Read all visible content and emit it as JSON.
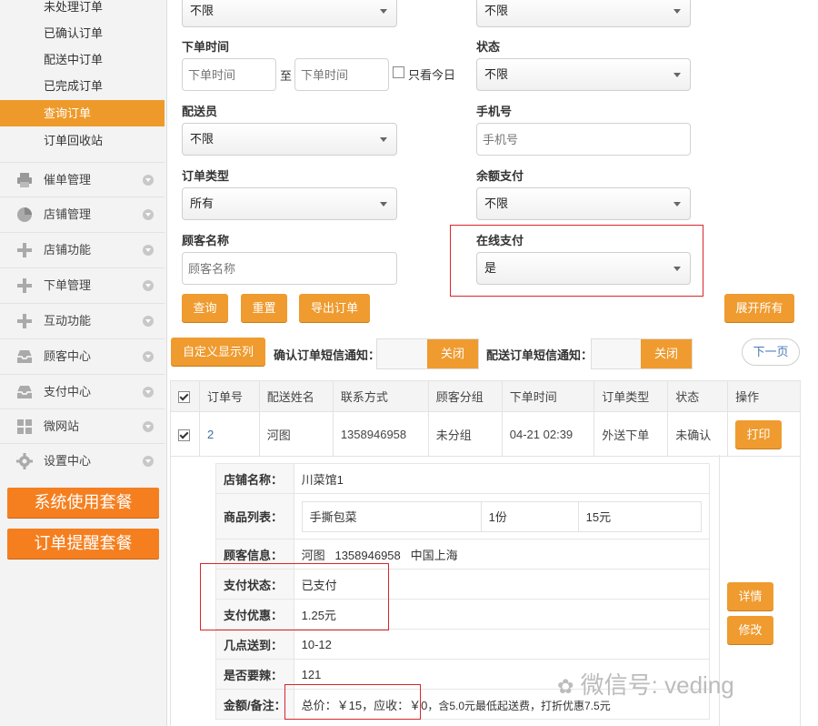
{
  "sidebar": {
    "sub_items": [
      {
        "label": "未处理订单",
        "active": false
      },
      {
        "label": "已确认订单",
        "active": false
      },
      {
        "label": "配送中订单",
        "active": false
      },
      {
        "label": "已完成订单",
        "active": false
      },
      {
        "label": "查询订单",
        "active": true
      },
      {
        "label": "订单回收站",
        "active": false
      }
    ],
    "sections": [
      {
        "label": "催单管理",
        "icon": "printer-icon"
      },
      {
        "label": "店铺管理",
        "icon": "pie-chart-icon"
      },
      {
        "label": "店铺功能",
        "icon": "plus-icon"
      },
      {
        "label": "下单管理",
        "icon": "plus-icon"
      },
      {
        "label": "互动功能",
        "icon": "plus-icon"
      },
      {
        "label": "顾客中心",
        "icon": "inbox-icon"
      },
      {
        "label": "支付中心",
        "icon": "inbox-icon"
      },
      {
        "label": "微网站",
        "icon": "grid-icon"
      },
      {
        "label": "设置中心",
        "icon": "gear-icon"
      }
    ],
    "big_buttons": [
      "系统使用套餐",
      "订单提醒套餐"
    ]
  },
  "filters": {
    "top_left_value": "不限",
    "top_right_value": "不限",
    "order_time_label": "下单时间",
    "order_time_from_placeholder": "下单时间",
    "order_time_sep": "至",
    "order_time_to_placeholder": "下单时间",
    "today_only_label": "只看今日",
    "status_label": "状态",
    "status_value": "不限",
    "courier_label": "配送员",
    "courier_value": "不限",
    "phone_label": "手机号",
    "phone_placeholder": "手机号",
    "order_type_label": "订单类型",
    "order_type_value": "所有",
    "balance_pay_label": "余额支付",
    "balance_pay_value": "不限",
    "customer_name_label": "顾客名称",
    "customer_name_placeholder": "顾客名称",
    "online_pay_label": "在线支付",
    "online_pay_value": "是"
  },
  "actions": {
    "query": "查询",
    "reset": "重置",
    "export": "导出订单",
    "expand_all": "展开所有",
    "custom_columns": "自定义显示列",
    "confirm_sms_label": "确认订单短信通知：",
    "confirm_sms_toggle": "关闭",
    "delivery_sms_label": "配送订单短信通知：",
    "delivery_sms_toggle": "关闭",
    "next_page": "下一页"
  },
  "table": {
    "headers": [
      "订单号",
      "配送姓名",
      "联系方式",
      "顾客分组",
      "下单时间",
      "订单类型",
      "状态",
      "操作"
    ],
    "row": {
      "order_no": "2",
      "name": "河图",
      "phone": "1358946958",
      "group": "未分组",
      "time": "04-21 02:39",
      "type": "外送下单",
      "status": "未确认",
      "print_button": "打印"
    }
  },
  "detail": {
    "shop_label": "店铺名称：",
    "shop_value": "川菜馆1",
    "goods_label": "商品列表：",
    "goods": {
      "name": "手撕包菜",
      "qty": "1份",
      "price": "15元"
    },
    "customer_label": "顾客信息：",
    "customer_value": "河图   1358946958   中国上海",
    "pay_status_label": "支付状态：",
    "pay_status_value": "已支付",
    "pay_discount_label": "支付优惠：",
    "pay_discount_value": "1.25元",
    "delivery_time_label": "几点送到：",
    "delivery_time_value": "10-12",
    "spicy_label": "是否要辣：",
    "spicy_value": "121",
    "amount_label": "金额/备注：",
    "amount_total": "总价：￥15，应收：￥0",
    "amount_note": "，含5.0元最低起送费，打折优惠7.5元",
    "details_button": "详情",
    "modify_button": "修改"
  },
  "watermark": "微信号: veding",
  "colors": {
    "accent": "#ef9b2f",
    "sidebar_active": "#ee9a2a",
    "big_button": "#f57f1f",
    "highlight_box": "#d9252a"
  }
}
